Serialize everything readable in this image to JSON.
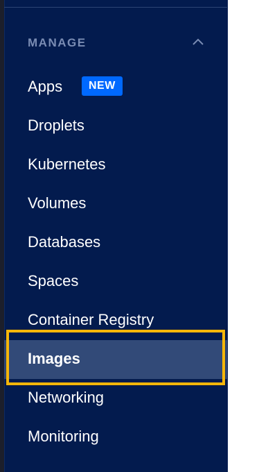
{
  "section": {
    "title": "MANAGE",
    "collapse_icon": "chevron-up-icon"
  },
  "nav": {
    "items": [
      {
        "label": "Apps",
        "badge": "NEW"
      },
      {
        "label": "Droplets"
      },
      {
        "label": "Kubernetes"
      },
      {
        "label": "Volumes"
      },
      {
        "label": "Databases"
      },
      {
        "label": "Spaces"
      },
      {
        "label": "Container Registry"
      },
      {
        "label": "Images",
        "active": true
      },
      {
        "label": "Networking"
      },
      {
        "label": "Monitoring"
      }
    ]
  },
  "colors": {
    "sidebar_bg": "#031b4e",
    "active_bg": "#324a78",
    "badge_bg": "#0069ff",
    "highlight": "#f5b60a",
    "section_title": "#7a8cb3"
  }
}
